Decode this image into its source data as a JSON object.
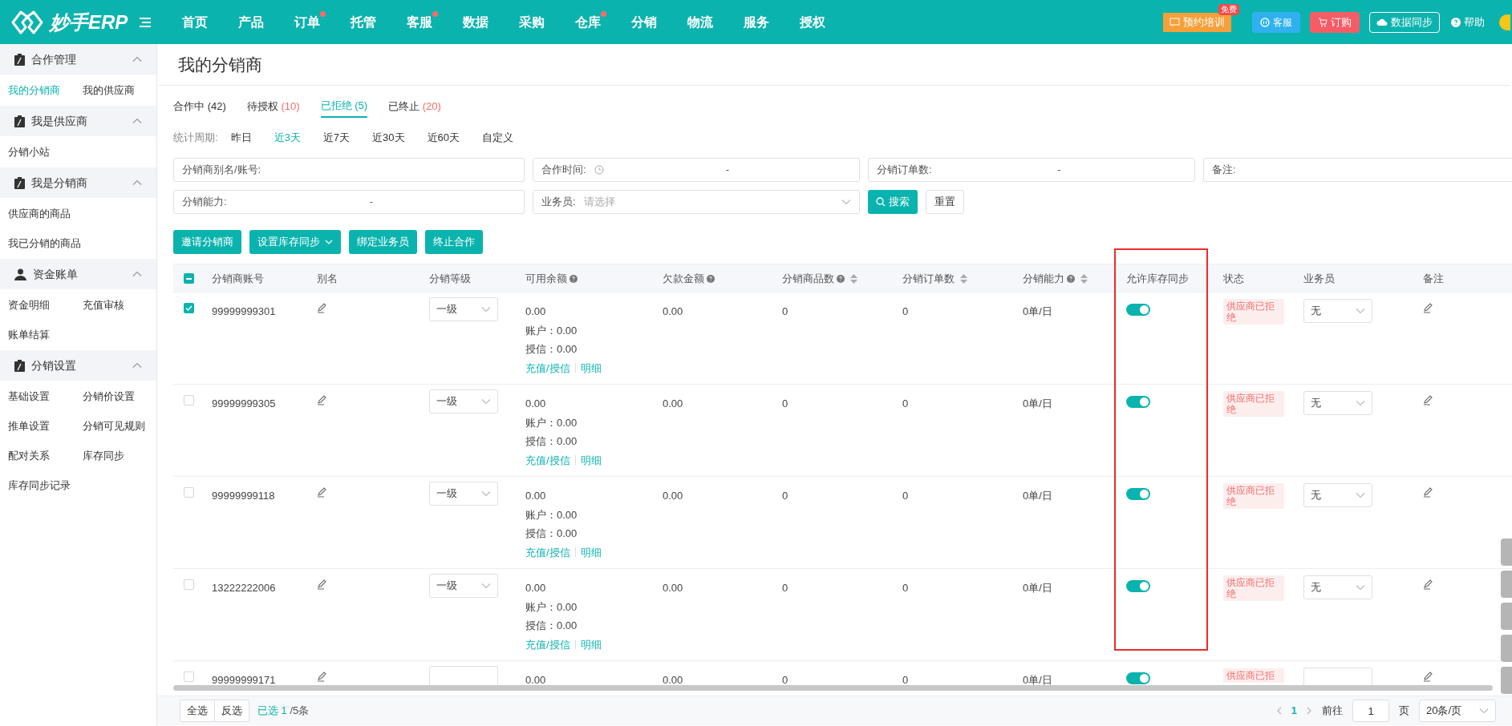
{
  "topbar": {
    "logo": "妙手ERP",
    "nav": [
      {
        "label": "首页",
        "dot": false
      },
      {
        "label": "产品",
        "dot": false
      },
      {
        "label": "订单",
        "dot": true
      },
      {
        "label": "托管",
        "dot": false
      },
      {
        "label": "客服",
        "dot": true
      },
      {
        "label": "数据",
        "dot": false
      },
      {
        "label": "采购",
        "dot": false
      },
      {
        "label": "仓库",
        "dot": true
      },
      {
        "label": "分销",
        "dot": false
      },
      {
        "label": "物流",
        "dot": false
      },
      {
        "label": "服务",
        "dot": false
      },
      {
        "label": "授权",
        "dot": false
      }
    ],
    "actions": [
      {
        "kind": "training",
        "label": "预约培训",
        "badge": "免费"
      },
      {
        "kind": "service",
        "label": "客服"
      },
      {
        "kind": "order",
        "label": "订购"
      },
      {
        "kind": "sync",
        "label": "数据同步"
      },
      {
        "kind": "help",
        "label": "帮助"
      }
    ]
  },
  "sidebar": [
    {
      "title": "合作管理",
      "kind": "management",
      "items": [
        {
          "label": "我的分销商",
          "selected": true
        },
        {
          "label": "我的供应商",
          "selected": false
        }
      ]
    },
    {
      "title": "我是供应商",
      "kind": "management",
      "items": [
        {
          "label": "分销小站",
          "selected": false
        }
      ]
    },
    {
      "title": "我是分销商",
      "kind": "list",
      "items": [
        {
          "label": "供应商的商品",
          "selected": false
        },
        {
          "label": "我已分销的商品",
          "selected": false
        }
      ]
    },
    {
      "title": "资金账单",
      "kind": "finance",
      "items": [
        {
          "label": "资金明细",
          "selected": false
        },
        {
          "label": "充值审核",
          "selected": false
        },
        {
          "label": "账单结算",
          "selected": false
        }
      ]
    },
    {
      "title": "分销设置",
      "kind": "management",
      "items": [
        {
          "label": "基础设置",
          "selected": false
        },
        {
          "label": "分销价设置",
          "selected": false
        },
        {
          "label": "推单设置",
          "selected": false
        },
        {
          "label": "分销可见规则",
          "selected": false
        },
        {
          "label": "配对关系",
          "selected": false
        },
        {
          "label": "库存同步",
          "selected": false
        },
        {
          "label": "库存同步记录",
          "selected": false
        }
      ]
    }
  ],
  "page_title": "我的分销商",
  "tabs": [
    {
      "label": "合作中",
      "count": "(42)",
      "selected": false,
      "count_red": false
    },
    {
      "label": "待授权",
      "count": "(10)",
      "selected": false,
      "count_red": true
    },
    {
      "label": "已拒绝",
      "count": "(5)",
      "selected": true,
      "count_red": false
    },
    {
      "label": "已终止",
      "count": "(20)",
      "selected": false,
      "count_red": true
    }
  ],
  "period": {
    "label": "统计周期:",
    "options": [
      {
        "label": "昨日",
        "selected": false
      },
      {
        "label": "近3天",
        "selected": true
      },
      {
        "label": "近7天",
        "selected": false
      },
      {
        "label": "近30天",
        "selected": false
      },
      {
        "label": "近60天",
        "selected": false
      },
      {
        "label": "自定义",
        "selected": false
      }
    ]
  },
  "filters": [
    {
      "kind": "text",
      "label": "分销商别名/账号:"
    },
    {
      "kind": "date_range",
      "label": "合作时间:",
      "separator": "-"
    },
    {
      "kind": "range",
      "label": "分销订单数:",
      "separator": "-"
    },
    {
      "kind": "text",
      "label": "备注:"
    },
    {
      "kind": "range",
      "label": "分销能力:",
      "separator": "-"
    },
    {
      "kind": "select",
      "label": "业务员:",
      "placeholder": "请选择"
    }
  ],
  "search_button": "搜索",
  "reset_button": "重置",
  "actions": [
    {
      "label": "邀请分销商",
      "dropdown": false
    },
    {
      "label": "设置库存同步",
      "dropdown": true
    },
    {
      "label": "绑定业务员",
      "dropdown": false
    },
    {
      "label": "终止合作",
      "dropdown": false
    }
  ],
  "table": {
    "select_all_indeterminate": true,
    "columns": [
      {
        "label": "分销商账号",
        "help": false,
        "sortable": false,
        "highlighted": false
      },
      {
        "label": "别名",
        "help": false,
        "sortable": false,
        "highlighted": false
      },
      {
        "label": "分销等级",
        "help": false,
        "sortable": false,
        "highlighted": false
      },
      {
        "label": "可用余额",
        "help": true,
        "sortable": false,
        "highlighted": false
      },
      {
        "label": "欠款金额",
        "help": true,
        "sortable": false,
        "highlighted": false
      },
      {
        "label": "分销商品数",
        "help": true,
        "sortable": true,
        "highlighted": false
      },
      {
        "label": "分销订单数",
        "help": false,
        "sortable": true,
        "highlighted": false
      },
      {
        "label": "分销能力",
        "help": true,
        "sortable": true,
        "highlighted": false
      },
      {
        "label": "允许库存同步",
        "help": false,
        "sortable": false,
        "highlighted": true
      },
      {
        "label": "状态",
        "help": false,
        "sortable": false,
        "highlighted": false
      },
      {
        "label": "业务员",
        "help": false,
        "sortable": false,
        "highlighted": false
      },
      {
        "label": "备注",
        "help": false,
        "sortable": false,
        "highlighted": false
      }
    ],
    "rows": [
      {
        "checked": true,
        "account": "99999999301",
        "level": "一级",
        "balance": "0.00",
        "details": [
          {
            "label": "账户：",
            "value": "0.00"
          },
          {
            "label": "授信：",
            "value": "0.00"
          }
        ],
        "links": [
          "充值/授信",
          "明细"
        ],
        "debt": "0.00",
        "goods": "0",
        "orders": "0",
        "capacity": "0单/日",
        "sync_on": true,
        "status": "供应商已拒绝",
        "salesman": "无"
      },
      {
        "checked": false,
        "account": "99999999305",
        "level": "一级",
        "balance": "0.00",
        "details": [
          {
            "label": "账户：",
            "value": "0.00"
          },
          {
            "label": "授信：",
            "value": "0.00"
          }
        ],
        "links": [
          "充值/授信",
          "明细"
        ],
        "debt": "0.00",
        "goods": "0",
        "orders": "0",
        "capacity": "0单/日",
        "sync_on": true,
        "status": "供应商已拒绝",
        "salesman": "无"
      },
      {
        "checked": false,
        "account": "99999999118",
        "level": "一级",
        "balance": "0.00",
        "details": [
          {
            "label": "账户：",
            "value": "0.00"
          },
          {
            "label": "授信：",
            "value": "0.00"
          }
        ],
        "links": [
          "充值/授信",
          "明细"
        ],
        "debt": "0.00",
        "goods": "0",
        "orders": "0",
        "capacity": "0单/日",
        "sync_on": true,
        "status": "供应商已拒绝",
        "salesman": "无"
      },
      {
        "checked": false,
        "account": "13222222006",
        "level": "一级",
        "balance": "0.00",
        "details": [
          {
            "label": "账户：",
            "value": "0.00"
          },
          {
            "label": "授信：",
            "value": "0.00"
          }
        ],
        "links": [
          "充值/授信",
          "明细"
        ],
        "debt": "0.00",
        "goods": "0",
        "orders": "0",
        "capacity": "0单/日",
        "sync_on": true,
        "status": "供应商已拒绝",
        "salesman": "无"
      },
      {
        "checked": false,
        "account": "99999999171",
        "balance": "0.00",
        "details": [],
        "links": [],
        "debt": "0.00",
        "goods": "0",
        "orders": "0",
        "capacity": "0单/日",
        "sync_on": true,
        "status": "供应商已拒"
      }
    ]
  },
  "footer": {
    "select_all": "全选",
    "invert": "反选",
    "selected_prefix": "已选",
    "selected_count": "1",
    "selected_suffix": "/5条",
    "current_page": "1",
    "goto": "前往",
    "page_input": "1",
    "page_unit": "页",
    "page_size": "20条/页"
  }
}
